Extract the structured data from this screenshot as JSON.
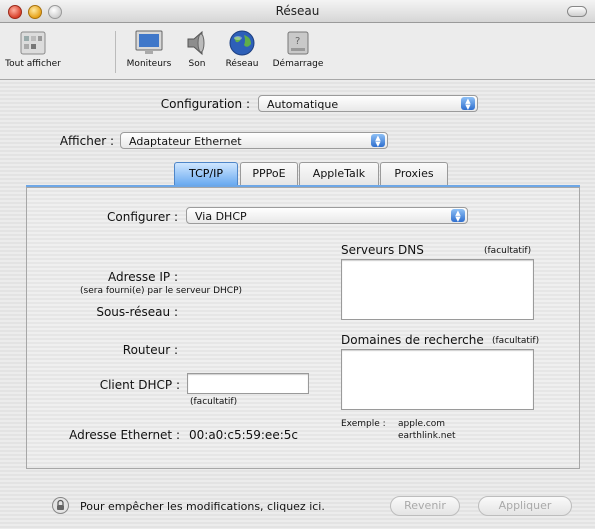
{
  "window": {
    "title": "Réseau"
  },
  "toolbar": {
    "items": [
      {
        "label": "Tout afficher",
        "icon": "show-all-icon"
      },
      {
        "label": "Moniteurs",
        "icon": "monitor-icon"
      },
      {
        "label": "Son",
        "icon": "speaker-icon"
      },
      {
        "label": "Réseau",
        "icon": "globe-icon"
      },
      {
        "label": "Démarrage",
        "icon": "startup-disk-icon"
      }
    ]
  },
  "configuration": {
    "label": "Configuration :",
    "value": "Automatique"
  },
  "afficher": {
    "label": "Afficher :",
    "value": "Adaptateur Ethernet"
  },
  "tabs": [
    {
      "label": "TCP/IP",
      "selected": true
    },
    {
      "label": "PPPoE",
      "selected": false
    },
    {
      "label": "AppleTalk",
      "selected": false
    },
    {
      "label": "Proxies",
      "selected": false
    }
  ],
  "tcpip": {
    "configurer_label": "Configurer :",
    "configurer_value": "Via DHCP",
    "ip_label": "Adresse IP :",
    "ip_note": "(sera fourni(e) par le serveur DHCP)",
    "subnet_label": "Sous-réseau :",
    "router_label": "Routeur :",
    "dhcp_client_label": "Client DHCP :",
    "dhcp_client_value": "",
    "dhcp_client_optional": "(facultatif)",
    "ethernet_label": "Adresse Ethernet :",
    "ethernet_value": "00:a0:c5:59:ee:5c",
    "dns_label": "Serveurs DNS",
    "dns_optional": "(facultatif)",
    "search_label": "Domaines de recherche",
    "search_optional": "(facultatif)",
    "example_label": "Exemple :",
    "example_1": "apple.com",
    "example_2": "earthlink.net"
  },
  "footer": {
    "lock_text": "Pour empêcher les modifications, cliquez ici.",
    "revert": "Revenir",
    "apply": "Appliquer"
  }
}
